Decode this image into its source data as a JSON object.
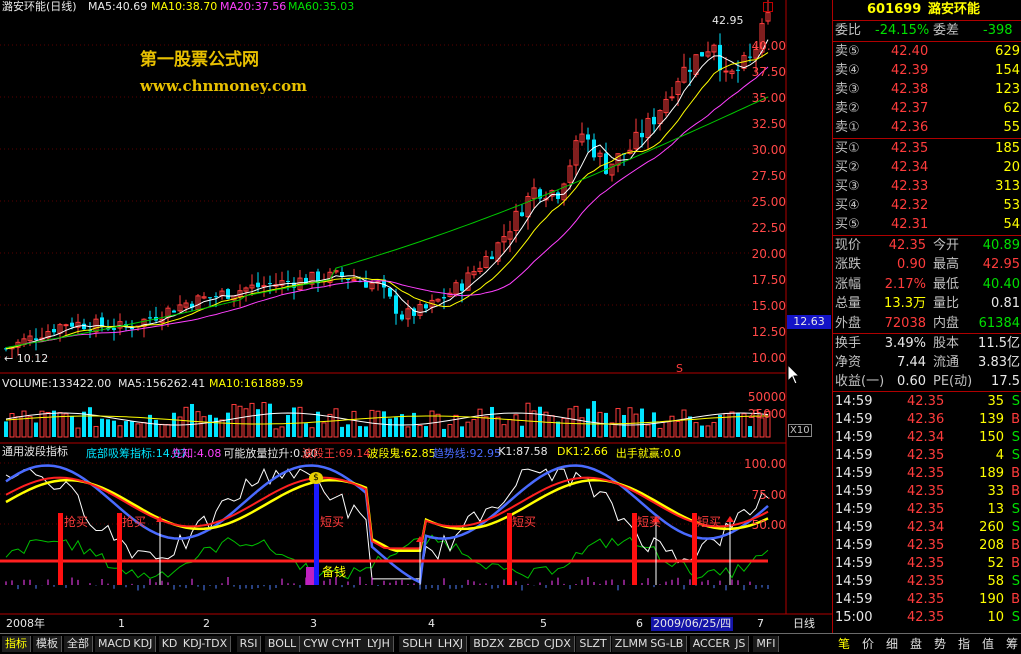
{
  "header": {
    "stock_name": "潞安环能(日线)",
    "ma5": "MA5:40.69",
    "ma10": "MA10:38.70",
    "ma20": "MA20:37.56",
    "ma60": "MA60:35.03"
  },
  "watermark": {
    "line1": "第一股票公式网",
    "line2": "www.chnmoney.com"
  },
  "price_chart": {
    "high_label": "42.95",
    "low_label": "← 10.12",
    "cursor_price": "12.63",
    "s_marker": "S",
    "y_ticks": [
      "40.00",
      "37.50",
      "35.00",
      "32.50",
      "30.00",
      "27.50",
      "25.00",
      "22.50",
      "20.00",
      "17.50",
      "15.00",
      "12.50",
      "10.00"
    ]
  },
  "volume_panel": {
    "title": "VOLUME:133422.00",
    "ma5": "MA5:156262.41",
    "ma10": "MA10:161889.59",
    "y_ticks": [
      "50000",
      "25000"
    ],
    "multiplier": "X10"
  },
  "indicator_panel": {
    "name": "通用波段指标",
    "items": [
      {
        "label": "底部吸筹指标:14.07",
        "color": "#00e5ff"
      },
      {
        "label": "先知:4.08",
        "color": "#ff40ff"
      },
      {
        "label": "可能放量拉升:0.00",
        "color": "#e8e8e8"
      },
      {
        "label": "波段王:69.14",
        "color": "#ff3c3c"
      },
      {
        "label": "波段鬼:62.85",
        "color": "#ffff00"
      },
      {
        "label": "趋势线:92.95",
        "color": "#4a6bff"
      },
      {
        "label": "K1:87.58",
        "color": "#e8e8e8"
      },
      {
        "label": "DK1:2.66",
        "color": "#ffff00"
      },
      {
        "label": "出手就赢:0.0",
        "color": "#ffff00"
      }
    ],
    "y_ticks": [
      "100.00",
      "75.00",
      "50.00"
    ],
    "signal_labels": [
      "抢买",
      "抢买",
      "短买",
      "短买",
      "短买",
      "短买"
    ],
    "beiqian_label": "备钱",
    "coin_label": "$"
  },
  "time_axis": {
    "labels": [
      "2008年",
      "1",
      "2",
      "3",
      "4",
      "5",
      "6",
      "7"
    ],
    "cursor_date": "2009/06/25/四",
    "period_button": "日线"
  },
  "quote": {
    "code": "601699",
    "name": "潞安环能",
    "weibi_label": "委比",
    "weibi_value": "-24.15%",
    "weicha_label": "委差",
    "weicha_value": "-398",
    "asks": [
      {
        "label": "卖⑤",
        "price": "42.40",
        "vol": "629"
      },
      {
        "label": "卖④",
        "price": "42.39",
        "vol": "154"
      },
      {
        "label": "卖③",
        "price": "42.38",
        "vol": "123"
      },
      {
        "label": "卖②",
        "price": "42.37",
        "vol": "62"
      },
      {
        "label": "卖①",
        "price": "42.36",
        "vol": "55"
      }
    ],
    "bids": [
      {
        "label": "买①",
        "price": "42.35",
        "vol": "185"
      },
      {
        "label": "买②",
        "price": "42.34",
        "vol": "20"
      },
      {
        "label": "买③",
        "price": "42.33",
        "vol": "313"
      },
      {
        "label": "买④",
        "price": "42.32",
        "vol": "53"
      },
      {
        "label": "买⑤",
        "price": "42.31",
        "vol": "54"
      }
    ],
    "stats": [
      {
        "l1": "现价",
        "v1": "42.35",
        "c1": "#ff3c3c",
        "l2": "今开",
        "v2": "40.89",
        "c2": "#00e000"
      },
      {
        "l1": "涨跌",
        "v1": "0.90",
        "c1": "#ff3c3c",
        "l2": "最高",
        "v2": "42.95",
        "c2": "#ff3c3c"
      },
      {
        "l1": "涨幅",
        "v1": "2.17%",
        "c1": "#ff3c3c",
        "l2": "最低",
        "v2": "40.40",
        "c2": "#00e000"
      },
      {
        "l1": "总量",
        "v1": "13.3万",
        "c1": "#ffff00",
        "l2": "量比",
        "v2": "0.81",
        "c2": "#e8e8e8"
      },
      {
        "l1": "外盘",
        "v1": "72038",
        "c1": "#ff3c3c",
        "l2": "内盘",
        "v2": "61384",
        "c2": "#00e000"
      }
    ],
    "fundamentals": [
      {
        "l1": "换手",
        "v1": "3.49%",
        "l2": "股本",
        "v2": "11.5亿"
      },
      {
        "l1": "净资",
        "v1": "7.44",
        "l2": "流通",
        "v2": "3.83亿"
      },
      {
        "l1": "收益(一)",
        "v1": "0.60",
        "l2": "PE(动)",
        "v2": "17.5"
      }
    ],
    "ticks": [
      {
        "time": "14:59",
        "price": "42.35",
        "vol": "35",
        "bs": "S"
      },
      {
        "time": "14:59",
        "price": "42.36",
        "vol": "139",
        "bs": "B"
      },
      {
        "time": "14:59",
        "price": "42.34",
        "vol": "150",
        "bs": "S"
      },
      {
        "time": "14:59",
        "price": "42.35",
        "vol": "4",
        "bs": "S"
      },
      {
        "time": "14:59",
        "price": "42.35",
        "vol": "189",
        "bs": "B"
      },
      {
        "time": "14:59",
        "price": "42.35",
        "vol": "33",
        "bs": "B"
      },
      {
        "time": "14:59",
        "price": "42.35",
        "vol": "13",
        "bs": "S"
      },
      {
        "time": "14:59",
        "price": "42.34",
        "vol": "260",
        "bs": "S"
      },
      {
        "time": "14:59",
        "price": "42.35",
        "vol": "208",
        "bs": "B"
      },
      {
        "time": "14:59",
        "price": "42.35",
        "vol": "52",
        "bs": "B"
      },
      {
        "time": "14:59",
        "price": "42.35",
        "vol": "58",
        "bs": "S"
      },
      {
        "time": "14:59",
        "price": "42.35",
        "vol": "190",
        "bs": "B"
      },
      {
        "time": "15:00",
        "price": "42.35",
        "vol": "10",
        "bs": "S"
      }
    ]
  },
  "bottom_tabs": [
    "指标",
    "模板",
    "全部",
    "MACD",
    "KDJ",
    "KD",
    "KDJ-TDX",
    "RSI",
    "BOLL",
    "CYW",
    "CYHT",
    "LYJH",
    "SDLH",
    "LHXJ",
    "BDZX",
    "ZBCD",
    "CJDX",
    "SLZT",
    "ZLMM",
    "SG-LB",
    "ACCER",
    "JS",
    "MFI"
  ],
  "right_tabs": [
    "笔",
    "价",
    "细",
    "盘",
    "势",
    "指",
    "值",
    "筹"
  ],
  "colors": {
    "up": "#ff3c3c",
    "down": "#00e5ff",
    "ma5": "#ffffff",
    "ma10": "#ffff00",
    "ma20": "#ff40ff",
    "ma60": "#00c800",
    "border": "#b00000"
  },
  "chart_data": {
    "type": "candlestick",
    "x_dates": [
      "2008年",
      "1",
      "2",
      "3",
      "4",
      "5",
      "6",
      "7"
    ],
    "y_range": [
      10.0,
      42.95
    ],
    "key_points": [
      {
        "label": "low",
        "value": 10.12
      },
      {
        "label": "high",
        "value": 42.95
      }
    ]
  }
}
